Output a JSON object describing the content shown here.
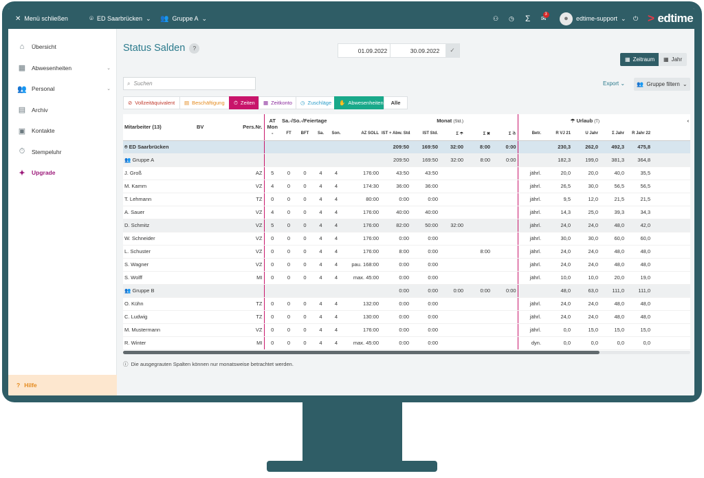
{
  "topbar": {
    "menu_label": "Menü schließen",
    "location": "ED Saarbrücken",
    "group": "Gruppe A",
    "mail_count": "3",
    "user": "edtime-support",
    "logo_prefix": ">",
    "logo_text": "edtime"
  },
  "sidebar": {
    "items": [
      {
        "label": "Übersicht",
        "icon": "home-icon"
      },
      {
        "label": "Abwesenheiten",
        "icon": "calendar-icon",
        "chevron": "⌄"
      },
      {
        "label": "Personal",
        "icon": "people-icon",
        "chevron": "⌄"
      },
      {
        "label": "Archiv",
        "icon": "archive-icon"
      },
      {
        "label": "Kontakte",
        "icon": "contacts-icon"
      },
      {
        "label": "Stempeluhr",
        "icon": "stopwatch-icon"
      },
      {
        "label": "Upgrade",
        "icon": "wand-icon"
      }
    ],
    "help": "Hilfe"
  },
  "page": {
    "title": "Status Salden",
    "help": "?",
    "date_from": "01.09.2022",
    "date_to": "30.09.2022",
    "zeitraum": "Zeitraum",
    "jahr": "Jahr",
    "search_placeholder": "Suchen",
    "export": "Export",
    "gruppe_filtern": "Gruppe filtern",
    "note": "Die ausgegrauten Spalten können nur monatsweise betrachtet werden."
  },
  "filters": [
    "Vollzeitäquivalent",
    "Beschäftigung",
    "Zeiten",
    "Zeitkonto",
    "Zuschläge",
    "Abwesenheiten",
    "Alle"
  ],
  "table": {
    "h_mitarbeiter": "Mitarbeiter (13)",
    "h_bv": "BV",
    "h_persnr": "Pers.Nr.",
    "h_at": "AT",
    "h_mon": "Mon",
    "h_dash": "-",
    "h_sasofeier": "Sa.-/So.-/Feiertage",
    "h_ft": "FT",
    "h_bft": "BFT",
    "h_sa": "Sa.",
    "h_son": "Son.",
    "h_monat": "Monat",
    "h_monat_unit": "(Std.)",
    "h_azsoll": "AZ SOLL",
    "h_istabw": "IST + Abw. Std.",
    "h_iststd": "IST Std.",
    "h_sigma1": "Σ ☂",
    "h_sigma2": "Σ ✖",
    "h_sigma3": "Σ ☃",
    "h_urlaub": "☂ Urlaub",
    "h_urlaub_unit": "(T)",
    "h_betr": "Betr.",
    "h_rvj": "R VJ 21",
    "h_ujahr": "U Jahr",
    "h_sjahr": "Σ Jahr",
    "h_rjahr": "R Jahr 22",
    "h_scroll": "‹",
    "rows": [
      {
        "type": "root",
        "name": "ED Saarbrücken",
        "c": [
          "",
          "",
          "",
          "",
          "",
          "",
          "",
          "209:50",
          "169:50",
          "32:00",
          "8:00",
          "0:00",
          "",
          "230,3",
          "262,0",
          "492,3",
          "475,8"
        ]
      },
      {
        "type": "grp",
        "name": "Gruppe A",
        "c": [
          "",
          "",
          "",
          "",
          "",
          "",
          "",
          "209:50",
          "169:50",
          "32:00",
          "8:00",
          "0:00",
          "",
          "182,3",
          "199,0",
          "381,3",
          "364,8"
        ]
      },
      {
        "type": "row",
        "name": "J. Groß",
        "c": [
          "",
          "AZ",
          "5",
          "0",
          "0",
          "4",
          "4",
          "176:00",
          "43:50",
          "43:50",
          "",
          "",
          "",
          "jährl.",
          "20,0",
          "20,0",
          "40,0",
          "35,5"
        ]
      },
      {
        "type": "row",
        "name": "M. Kamm",
        "c": [
          "",
          "VZ",
          "4",
          "0",
          "0",
          "4",
          "4",
          "174:30",
          "36:00",
          "36:00",
          "",
          "",
          "",
          "jährl.",
          "26,5",
          "30,0",
          "56,5",
          "56,5"
        ]
      },
      {
        "type": "row",
        "name": "T. Lehmann",
        "c": [
          "",
          "TZ",
          "0",
          "0",
          "0",
          "4",
          "4",
          "80:00",
          "0:00",
          "0:00",
          "",
          "",
          "",
          "jährl.",
          "9,5",
          "12,0",
          "21,5",
          "21,5"
        ]
      },
      {
        "type": "row",
        "name": "A. Sauer",
        "c": [
          "",
          "VZ",
          "4",
          "0",
          "0",
          "4",
          "4",
          "176:00",
          "40:00",
          "40:00",
          "",
          "",
          "",
          "jährl.",
          "14,3",
          "25,0",
          "39,3",
          "34,3"
        ]
      },
      {
        "type": "hl",
        "name": "D. Schmitz",
        "c": [
          "",
          "VZ",
          "5",
          "0",
          "0",
          "4",
          "4",
          "176:00",
          "82:00",
          "50:00",
          "32:00",
          "",
          "",
          "jährl.",
          "24,0",
          "24,0",
          "48,0",
          "42,0"
        ]
      },
      {
        "type": "row",
        "name": "W. Schneider",
        "c": [
          "",
          "VZ",
          "0",
          "0",
          "0",
          "4",
          "4",
          "176:00",
          "0:00",
          "0:00",
          "",
          "",
          "",
          "jährl.",
          "30,0",
          "30,0",
          "60,0",
          "60,0"
        ]
      },
      {
        "type": "row",
        "name": "L. Schuster",
        "c": [
          "",
          "VZ",
          "0",
          "0",
          "0",
          "4",
          "4",
          "176:00",
          "8:00",
          "0:00",
          "",
          "8:00",
          "",
          "jährl.",
          "24,0",
          "24,0",
          "48,0",
          "48,0"
        ]
      },
      {
        "type": "row",
        "name": "S. Wagner",
        "c": [
          "",
          "VZ",
          "0",
          "0",
          "0",
          "4",
          "4",
          "pau. 168:00",
          "0:00",
          "0:00",
          "",
          "",
          "",
          "jährl.",
          "24,0",
          "24,0",
          "48,0",
          "48,0"
        ]
      },
      {
        "type": "row",
        "name": "S. Wolff",
        "c": [
          "",
          "MI",
          "0",
          "0",
          "0",
          "4",
          "4",
          "max. 45:00",
          "0:00",
          "0:00",
          "",
          "",
          "",
          "jährl.",
          "10,0",
          "10,0",
          "20,0",
          "19,0"
        ]
      },
      {
        "type": "grp",
        "name": "Gruppe B",
        "c": [
          "",
          "",
          "",
          "",
          "",
          "",
          "",
          "0:00",
          "0:00",
          "0:00",
          "0:00",
          "0:00",
          "",
          "48,0",
          "63,0",
          "111,0",
          "111,0"
        ]
      },
      {
        "type": "row",
        "name": "O. Kühn",
        "c": [
          "",
          "TZ",
          "0",
          "0",
          "0",
          "4",
          "4",
          "132:00",
          "0:00",
          "0:00",
          "",
          "",
          "",
          "jährl.",
          "24,0",
          "24,0",
          "48,0",
          "48,0"
        ]
      },
      {
        "type": "row",
        "name": "C. Ludwig",
        "c": [
          "",
          "TZ",
          "0",
          "0",
          "0",
          "4",
          "4",
          "130:00",
          "0:00",
          "0:00",
          "",
          "",
          "",
          "jährl.",
          "24,0",
          "24,0",
          "48,0",
          "48,0"
        ]
      },
      {
        "type": "row",
        "name": "M. Mustermann",
        "c": [
          "",
          "VZ",
          "0",
          "0",
          "0",
          "4",
          "4",
          "176:00",
          "0:00",
          "0:00",
          "",
          "",
          "",
          "jährl.",
          "0,0",
          "15,0",
          "15,0",
          "15,0"
        ]
      },
      {
        "type": "row",
        "name": "R. Winter",
        "c": [
          "",
          "MI",
          "0",
          "0",
          "0",
          "4",
          "4",
          "max. 45:00",
          "0:00",
          "0:00",
          "",
          "",
          "",
          "dyn.",
          "0,0",
          "0,0",
          "0,0",
          "0,0"
        ]
      }
    ]
  }
}
